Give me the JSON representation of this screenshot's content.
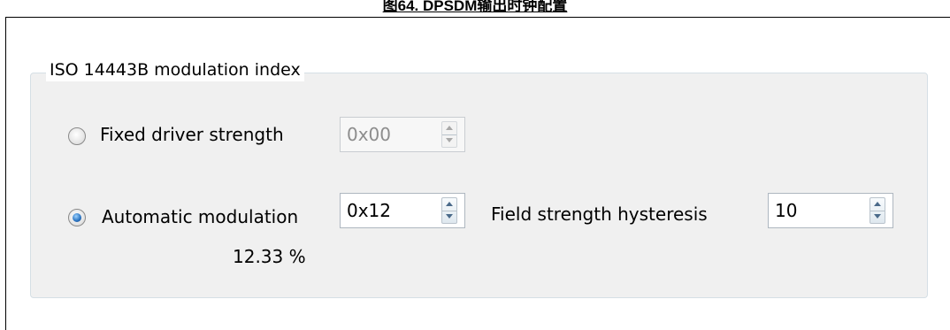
{
  "caption": "图64. DPSDM输出时钟配置",
  "group": {
    "title": "ISO 14443B modulation index"
  },
  "fixed_driver": {
    "label": "Fixed driver strength",
    "value": "0x00",
    "selected": false,
    "enabled": false
  },
  "automatic_modulation": {
    "label": "Automatic modulation",
    "value": "0x12",
    "percent": "12.33 %",
    "selected": true
  },
  "field_strength_hysteresis": {
    "label": "Field strength hysteresis",
    "value": "10"
  }
}
